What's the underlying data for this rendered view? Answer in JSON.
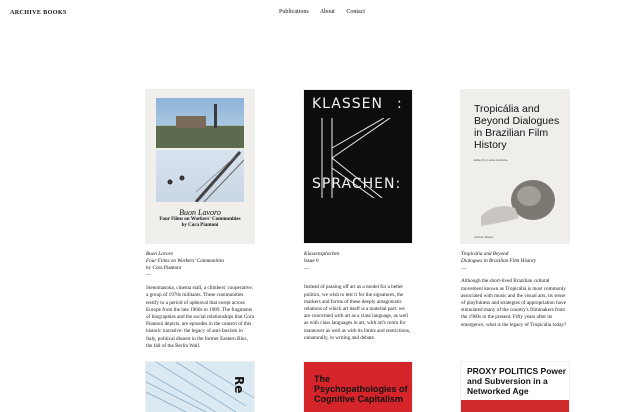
{
  "site": {
    "logo": "ARCHIVE BOOKS",
    "nav": [
      "Publications",
      "About",
      "Contact"
    ]
  },
  "books": [
    {
      "cover": {
        "script": "Buon Lavoro",
        "subtitle": "Four Films on Workers' Communities",
        "by": "by Cora Piantoni"
      },
      "title1": "Buon Lavoro",
      "title2": "Four Films on Workers' Communities",
      "author": "by Cora Piantoni",
      "dash": "—",
      "description": "Stenomasona, cinema stall, a climbers' cooperative, a group of 1970s militants. These communities testify to a period of upheaval that swept across Europe from the late 1960s to 1989. The fragments of biographies and the social relationships that Cora Piantoni depicts, are episodes in the context of this historic narrative: the legacy of anti-fascism in Italy, political dissent in the former Eastern Bloc, the fall of the Berlin Wall."
    },
    {
      "cover": {
        "line1": "KLASSEN",
        "line2": "SPRACHEN:",
        "colon": ":"
      },
      "title1": "Klassensprachen",
      "title2": "",
      "author": "Issue 0",
      "dash": "—",
      "description": "Instead of passing off art as a model for a better politics, we wish to test it for the signatures, the markers and forms of these deeply antagonistic relations of which art itself is a material part: we are concerned with art as a class language, as well as with class languages in art, with art's room for maneuver as well as with its limits and restrictions, unnaturally, in writing and debate."
    },
    {
      "cover": {
        "title": "Tropicália and Beyond Dialogues in Brazilian Film History",
        "edited": "Edited by Lucas Helmcke",
        "publisher": "Archive Books"
      },
      "title1": "Tropicália and Beyond",
      "title2": "Dialogues in Brazilian Film History",
      "author": "",
      "dash": "—",
      "description": "Although the short-lived Brazilian cultural movement known as Tropicália is most commonly associated with music and the visual arts, its sense of playfulness and strategies of appropriation have stimulated many of the country's filmmakers from the 1960s to the present. Fifty years after its emergence, what is the legacy of Tropicália today?"
    }
  ],
  "bottom_books": [
    {
      "cover_text": "Re"
    },
    {
      "cover_text": "The Psychopathologies of Cognitive Capitalism"
    },
    {
      "cover_text": "PROXY POLITICS Power and Subversion in a Networked Age"
    }
  ]
}
